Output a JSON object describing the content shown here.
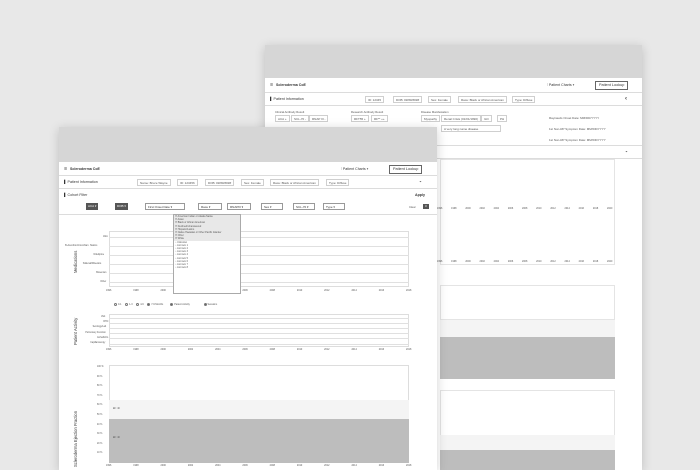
{
  "back": {
    "app_title": "Scleroderma CoE",
    "patient_charts": "Patient Charts",
    "patient_lookup": "Patient Lookup",
    "patient_information": "Patient Information",
    "id": "ID: 12345",
    "dob": "DOB: ##/##/####",
    "sex": "Sex: Female",
    "race": "Race: Black or African American",
    "type": "Type: Diffuse",
    "clinical_antibody": "Clinical Antibody Result",
    "research_antibody": "Research Antibody Result",
    "disease_manifestation": "Disease Manifestation",
    "clinical_tags": [
      "ACA +",
      "SCL-70 -",
      "RNAP III -"
    ],
    "research_tags": [
      "RFT55 +",
      "RF** ++"
    ],
    "manif_tags": [
      "Myopathy",
      "Renal Crisis (01/01/1990)",
      "ILD",
      "PH"
    ],
    "note": "A very long name disease",
    "raynauds_onset": "Raynauds Onset Date: MM/DD/YYYY",
    "first_non_rp": "1st Non-RP Symptom Date: MM/DD/YYYY",
    "first_non_rp2": "1st Non-RP Symptom Date: MM/DD/YYYY",
    "years": [
      "1996",
      "1998",
      "2000",
      "2002",
      "2004",
      "2006",
      "2008",
      "2010",
      "2012",
      "2014",
      "2016",
      "2018",
      "2020"
    ]
  },
  "front": {
    "app_title": "Scleroderma CoE",
    "patient_charts": "Patient Charts",
    "patient_lookup": "Patient Lookup",
    "patient_information": "Patient Information",
    "name": "Name: Bruce Wayne",
    "id": "ID: 123456",
    "dob": "DOB: ##/##/####",
    "sex": "Sex: Female",
    "race": "Race: Black or African American",
    "type": "Type: Diffuse",
    "cohort_filter": "Cohort Filter",
    "apply": "Apply",
    "clear": "Clear",
    "clear_count": "3",
    "filters_dark": [
      "ACA",
      "DOB"
    ],
    "filters": [
      "First Onset Date",
      "Race",
      "RNAPIII",
      "Sex",
      "SCL-70",
      "Type"
    ],
    "dropdown_items": [
      "American Indian or Alaska Native",
      "Asian",
      "Black or African American",
      "Declined/Unanswered",
      "Hispanic/Latino",
      "Native Hawaiian or Other Pacific Islander",
      "Other",
      "White",
      "",
      "Unknown",
      "List item 1",
      "List item 2",
      "List item 3",
      "List item 4",
      "List item 5",
      "List item 6",
      "List item 7",
      "List item 8"
    ],
    "medications_label": "Medications",
    "medication_rows": [
      "ASA",
      "B-Ascorbic/Anti-inflam. Statins",
      "Nifedipine",
      "Sildenafil/Revatio",
      "Bosentan",
      "Other"
    ],
    "activity_label": "Patient Activity",
    "activity_legend": [
      "0-1",
      "1-3",
      "4-6",
      "7-9 Months",
      "Patient Activity",
      "Sessions"
    ],
    "activity_rows": [
      "Visit",
      "RHC",
      "Serology/Lab",
      "Pulmonary Function",
      "Echo/ECG",
      "Capillaroscopy"
    ],
    "ef_label": "Scleroderma Ejection Fraction",
    "ef_ticks": [
      "100 %",
      "90 %",
      "80 %",
      "70 %",
      "60 %",
      "50 %",
      "40 %",
      "30 %",
      "20 %",
      "10 %"
    ],
    "ef_annotations": [
      "EF: 40",
      "EF: 40"
    ],
    "years": [
      "1996",
      "1998",
      "2000",
      "2002",
      "2004",
      "2006",
      "2008",
      "2010",
      "2012",
      "2014",
      "2016",
      "2018"
    ]
  }
}
